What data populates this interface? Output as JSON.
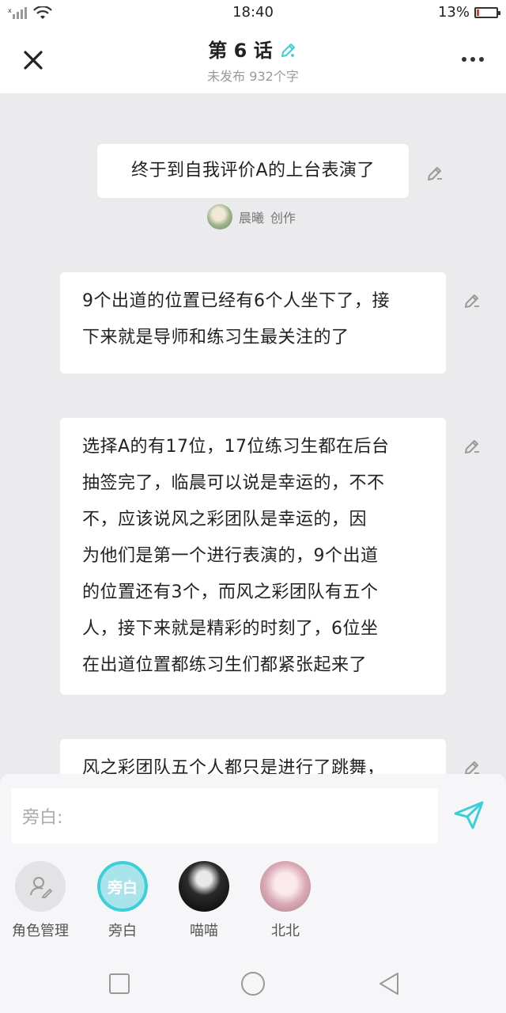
{
  "status_bar": {
    "time": "18:40",
    "battery_percent_text": "13%",
    "battery_level": 0.13,
    "battery_color": "#e53935"
  },
  "header": {
    "title": "第 6 话",
    "status": "未发布",
    "word_count": "932个字",
    "accent_color": "#3ccfd8",
    "icons": [
      "close-icon",
      "title-edit-icon",
      "more-icon"
    ]
  },
  "content": {
    "blocks": [
      {
        "text": "终于到自我评价A的上台表演了",
        "author": "晨曦",
        "author_suffix": "创作"
      },
      {
        "lines": [
          "9个出道的位置已经有6个人坐下了，接",
          "下来就是导师和练习生最关注的了"
        ]
      },
      {
        "lines": [
          "选择A的有17位，17位练习生都在后台",
          "抽签完了，临晨可以说是幸运的，不不",
          "不，应该说风之彩团队是幸运的，因",
          "为他们是第一个进行表演的，9个出道",
          "的位置还有3个，而风之彩团队有五个",
          "人，接下来就是精彩的时刻了，6位坐",
          "在出道位置都练习生们都紧张起来了"
        ]
      },
      {
        "lines": [
          "风之彩团队五个人都只是进行了跳舞，"
        ]
      }
    ]
  },
  "composer": {
    "placeholder": "旁白:",
    "send_icon": "send-icon"
  },
  "roles": [
    {
      "label": "角色管理",
      "icon": "role-manage-icon"
    },
    {
      "label": "旁白",
      "badge": "旁白",
      "selected": true
    },
    {
      "label": "喵喵",
      "icon": "avatar"
    },
    {
      "label": "北北",
      "icon": "avatar"
    }
  ],
  "navbar": {
    "icons": [
      "recent-apps-icon",
      "home-icon",
      "back-icon"
    ]
  }
}
